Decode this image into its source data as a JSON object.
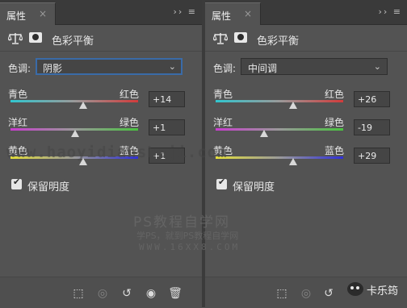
{
  "panels": [
    {
      "tab_label": "属性",
      "tab_close": "×",
      "tab_controls": "›› ≡",
      "header_title": "色彩平衡",
      "tone_label": "色调:",
      "tone_value": "阴影",
      "sliders": [
        {
          "left": "青色",
          "right": "红色",
          "value": "+14"
        },
        {
          "left": "洋红",
          "right": "绿色",
          "value": "+1"
        },
        {
          "left": "黄色",
          "right": "蓝色",
          "value": "+1"
        }
      ],
      "preserve_label": "保留明度",
      "preserve_checked": true
    },
    {
      "tab_label": "属性",
      "tab_close": "×",
      "tab_controls": "›› ≡",
      "header_title": "色彩平衡",
      "tone_label": "色调:",
      "tone_value": "中间调",
      "sliders": [
        {
          "left": "青色",
          "right": "红色",
          "value": "+26"
        },
        {
          "left": "洋红",
          "right": "绿色",
          "value": "-19"
        },
        {
          "left": "黄色",
          "right": "蓝色",
          "value": "+29"
        }
      ],
      "preserve_label": "保留明度",
      "preserve_checked": true
    }
  ],
  "footer_icons": [
    "clip-to-layer-icon",
    "view-previous-icon",
    "reset-icon",
    "visibility-eye-icon",
    "trash-icon"
  ],
  "watermarks": {
    "url": "www.haoyidianshejі.com",
    "brand": "PS教程自学网",
    "slogan": "学PS，就到PS教程自学网",
    "site": "WWW.16XX8.COM"
  },
  "badge": {
    "text": "卡乐筠"
  },
  "colors": {
    "panel_bg": "#535353",
    "cyan_red": [
      "#31c6cf",
      "#d23b3b"
    ],
    "magenta_green": [
      "#c93ccf",
      "#49c23f"
    ],
    "yellow_blue": [
      "#e4df3b",
      "#2f2fd8"
    ]
  }
}
